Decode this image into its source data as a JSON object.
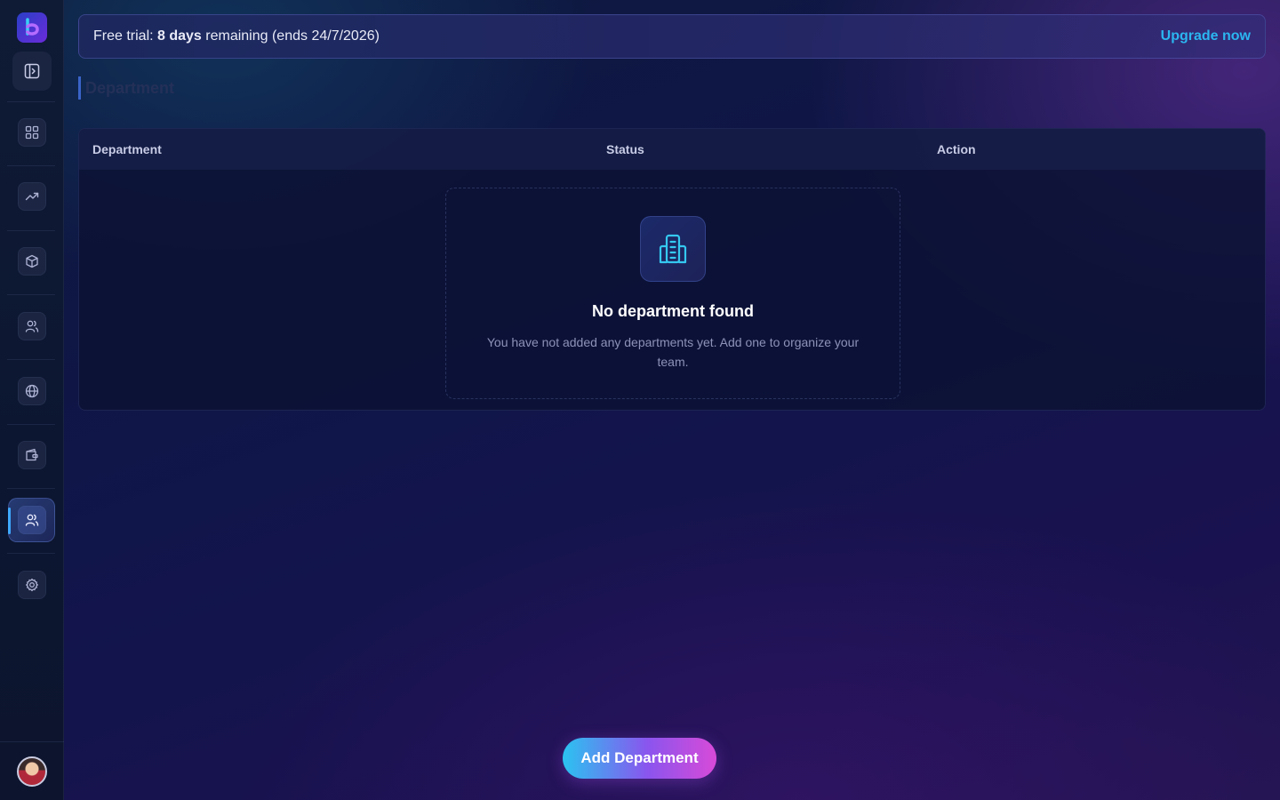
{
  "app": {
    "logo_icon": "brand-logo-icon",
    "collapse_icon": "sidebar-toggle-icon"
  },
  "sidebar": {
    "items": [
      {
        "icon": "dashboard-grid-icon"
      },
      {
        "icon": "trending-up-icon"
      },
      {
        "icon": "package-box-icon"
      },
      {
        "icon": "users-icon"
      },
      {
        "icon": "globe-icon"
      },
      {
        "icon": "wallet-icon"
      },
      {
        "icon": "team-icon",
        "active": true
      },
      {
        "icon": "settings-gear-icon"
      }
    ],
    "avatar": "user-avatar"
  },
  "trial": {
    "prefix": "Free trial: ",
    "days": "8 days",
    "suffix": " remaining (ends 24/7/2026)",
    "upgrade_label": "Upgrade now"
  },
  "page": {
    "title": "Department"
  },
  "table": {
    "columns": [
      "Department",
      "Status",
      "Action"
    ],
    "empty": {
      "icon": "building-icon",
      "title": "No department found",
      "description": "You have not added any departments yet. Add one to organize your team."
    }
  },
  "actions": {
    "add_label": "Add Department"
  },
  "colors": {
    "accent": "#2bb6f0",
    "active_indicator": "#3fa9ff",
    "button_gradient_start": "#2bc3f0",
    "button_gradient_end": "#d84ad8"
  }
}
